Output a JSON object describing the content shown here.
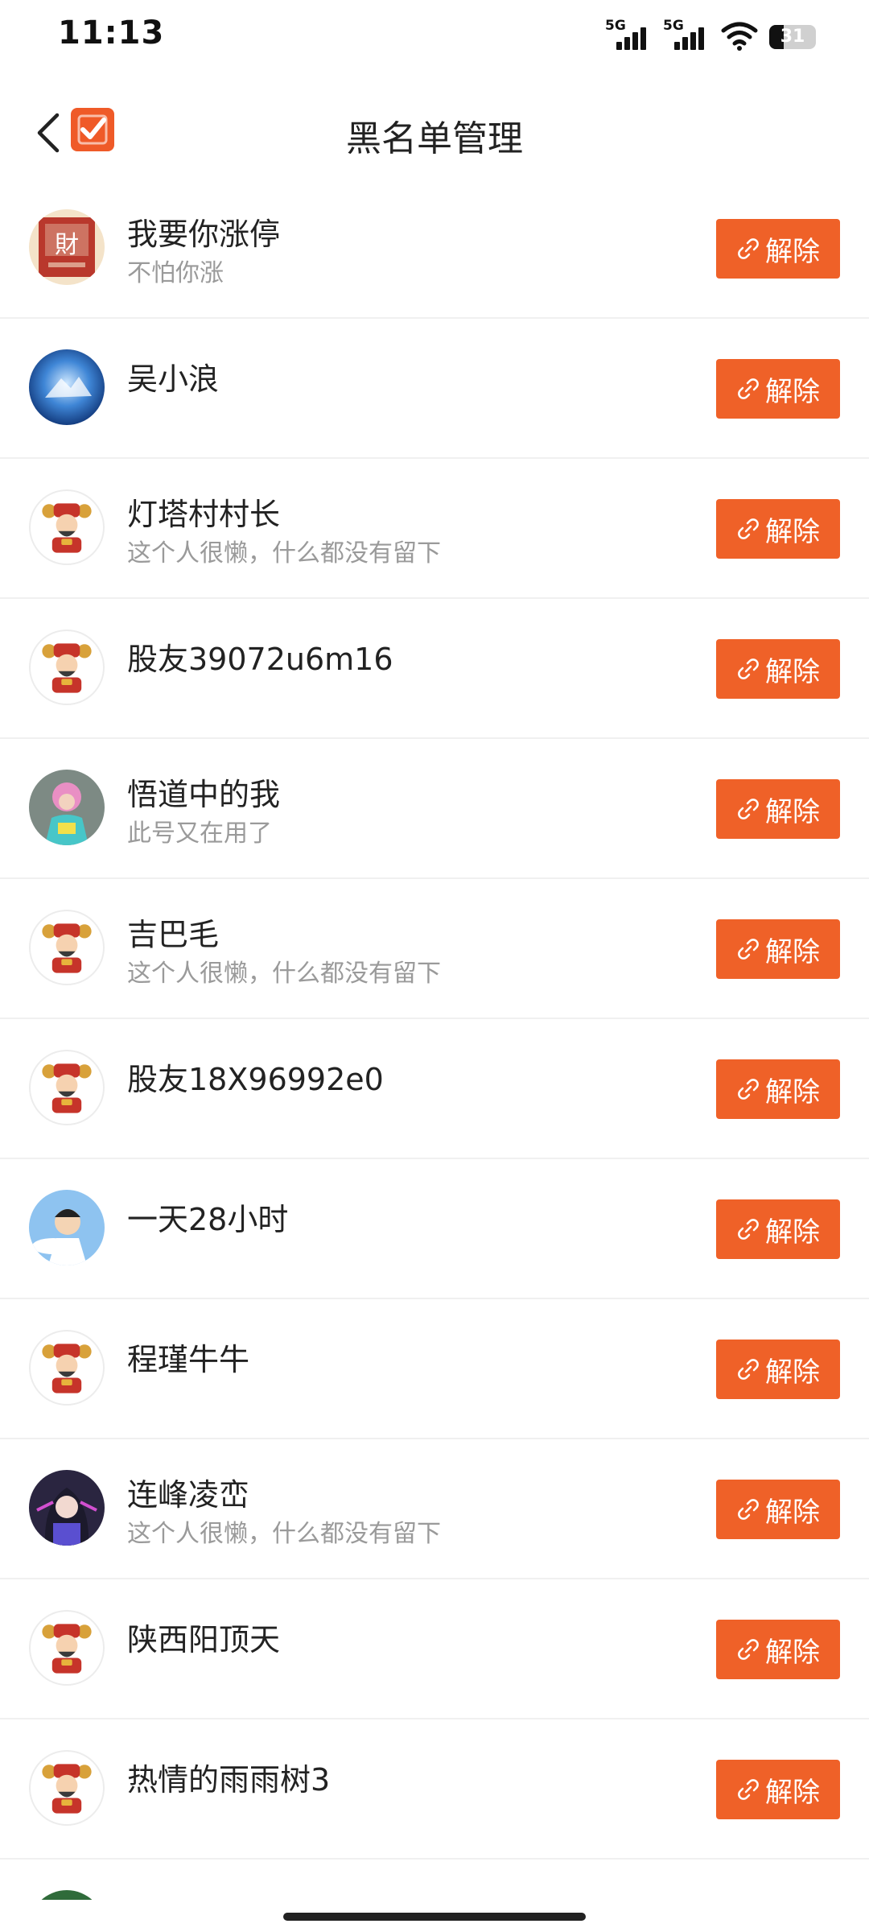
{
  "status_bar": {
    "time": "11:13",
    "signal_1": "5G",
    "signal_2": "5G",
    "battery": "31",
    "battery_level": 0.31
  },
  "header": {
    "title": "黑名单管理",
    "back_icon": "chevron-left-icon",
    "logo_icon": "check-square-icon"
  },
  "accent_color": "#ef6128",
  "unblock_icon": "unlink-icon",
  "items": [
    {
      "name": "我要你涨停",
      "sub": "不怕你涨",
      "action": "解除",
      "avatar": "photo-red-calligraphy"
    },
    {
      "name": "吴小浪",
      "sub": "",
      "action": "解除",
      "avatar": "photo-blue-earth"
    },
    {
      "name": "灯塔村村长",
      "sub": "这个人很懒，什么都没有留下",
      "action": "解除",
      "avatar": "default-fortune-god"
    },
    {
      "name": "股友39072u6m16",
      "sub": "",
      "action": "解除",
      "avatar": "default-fortune-god"
    },
    {
      "name": "悟道中的我",
      "sub": "此号又在用了",
      "action": "解除",
      "avatar": "photo-colorful-person"
    },
    {
      "name": "吉巴毛",
      "sub": "这个人很懒，什么都没有留下",
      "action": "解除",
      "avatar": "default-fortune-god"
    },
    {
      "name": "股友18X96992e0",
      "sub": "",
      "action": "解除",
      "avatar": "default-fortune-god"
    },
    {
      "name": "一天28小时",
      "sub": "",
      "action": "解除",
      "avatar": "photo-cartoon-sky"
    },
    {
      "name": "程瑾牛牛",
      "sub": "",
      "action": "解除",
      "avatar": "default-fortune-god"
    },
    {
      "name": "连峰凌峦",
      "sub": "这个人很懒，什么都没有留下",
      "action": "解除",
      "avatar": "photo-anime-girl"
    },
    {
      "name": "陕西阳顶天",
      "sub": "",
      "action": "解除",
      "avatar": "default-fortune-god"
    },
    {
      "name": "热情的雨雨树3",
      "sub": "",
      "action": "解除",
      "avatar": "default-fortune-god"
    }
  ]
}
